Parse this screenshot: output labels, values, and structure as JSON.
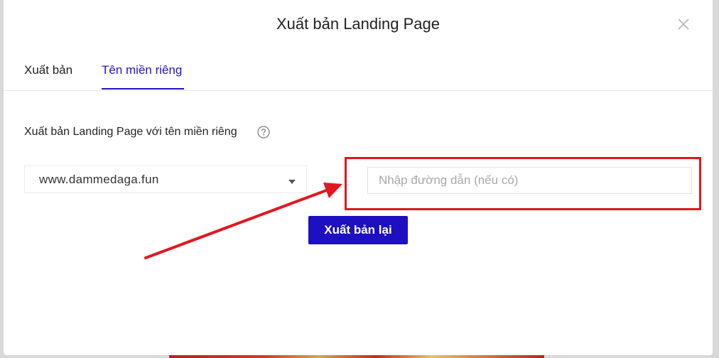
{
  "modal": {
    "title": "Xuất bản Landing Page"
  },
  "tabs": [
    {
      "label": "Xuất bản",
      "active": false
    },
    {
      "label": "Tên miền riêng",
      "active": true
    }
  ],
  "domain_section": {
    "label": "Xuất bản Landing Page với tên miền riêng",
    "selected_domain": "www.dammedaga.fun",
    "path_input": {
      "value": "",
      "placeholder": "Nhập đường dẫn (nếu có)"
    },
    "republish_label": "Xuất bản lại"
  },
  "icons": {
    "close": "close-icon",
    "help": "help-icon",
    "caret": "caret-down-icon"
  },
  "colors": {
    "accent": "#1d0fc2",
    "tab_active": "#2413c4",
    "annotation_red": "#e3161f"
  }
}
